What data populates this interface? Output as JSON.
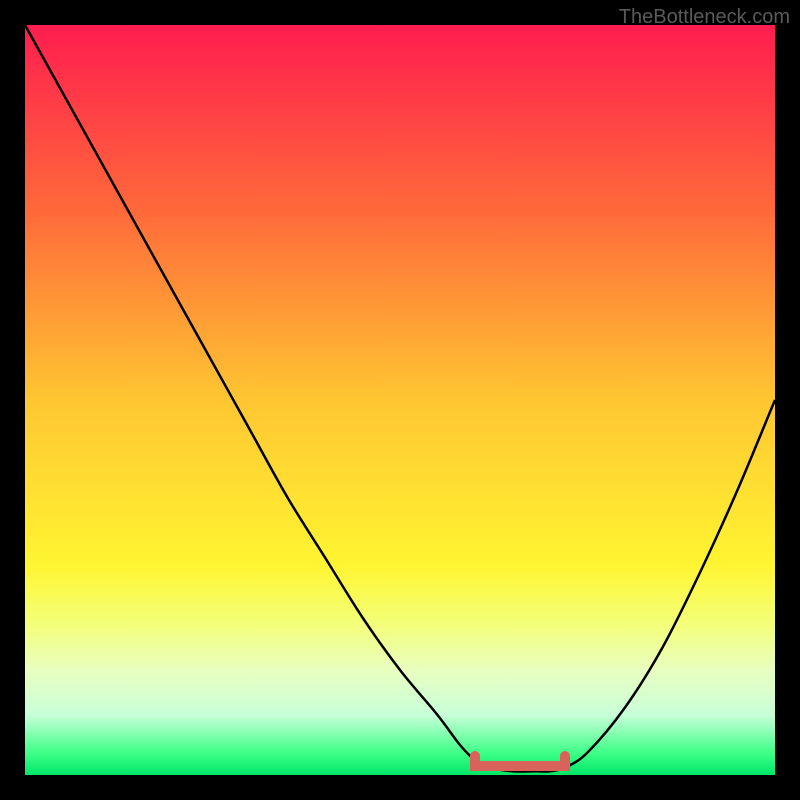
{
  "watermark": "TheBottleneck.com",
  "chart_data": {
    "type": "line",
    "title": "",
    "xlabel": "",
    "ylabel": "",
    "xlim": [
      0,
      100
    ],
    "ylim": [
      0,
      100
    ],
    "x": [
      0,
      5,
      10,
      15,
      20,
      25,
      30,
      35,
      40,
      45,
      50,
      55,
      58,
      60,
      62,
      65,
      68,
      70,
      72,
      75,
      80,
      85,
      90,
      95,
      100
    ],
    "values": [
      100,
      91,
      82,
      73,
      64,
      55,
      46,
      37,
      29,
      21,
      14,
      8,
      4,
      2,
      1,
      0.5,
      0.5,
      0.5,
      1,
      3,
      9,
      17,
      27,
      38,
      50
    ],
    "minimum_x_range": [
      60,
      72
    ],
    "gradient_stops": [
      {
        "offset": 0,
        "color": "#ff1d4f"
      },
      {
        "offset": 25,
        "color": "#ff6a3a"
      },
      {
        "offset": 50,
        "color": "#ffc632"
      },
      {
        "offset": 72,
        "color": "#fff531"
      },
      {
        "offset": 80,
        "color": "#f3ff7a"
      },
      {
        "offset": 86,
        "color": "#e8ffc0"
      },
      {
        "offset": 92,
        "color": "#c8ffd8"
      },
      {
        "offset": 97,
        "color": "#40ff88"
      },
      {
        "offset": 100,
        "color": "#00e768"
      }
    ],
    "curve_color": "#000000",
    "marker_color": "#d9635a"
  }
}
